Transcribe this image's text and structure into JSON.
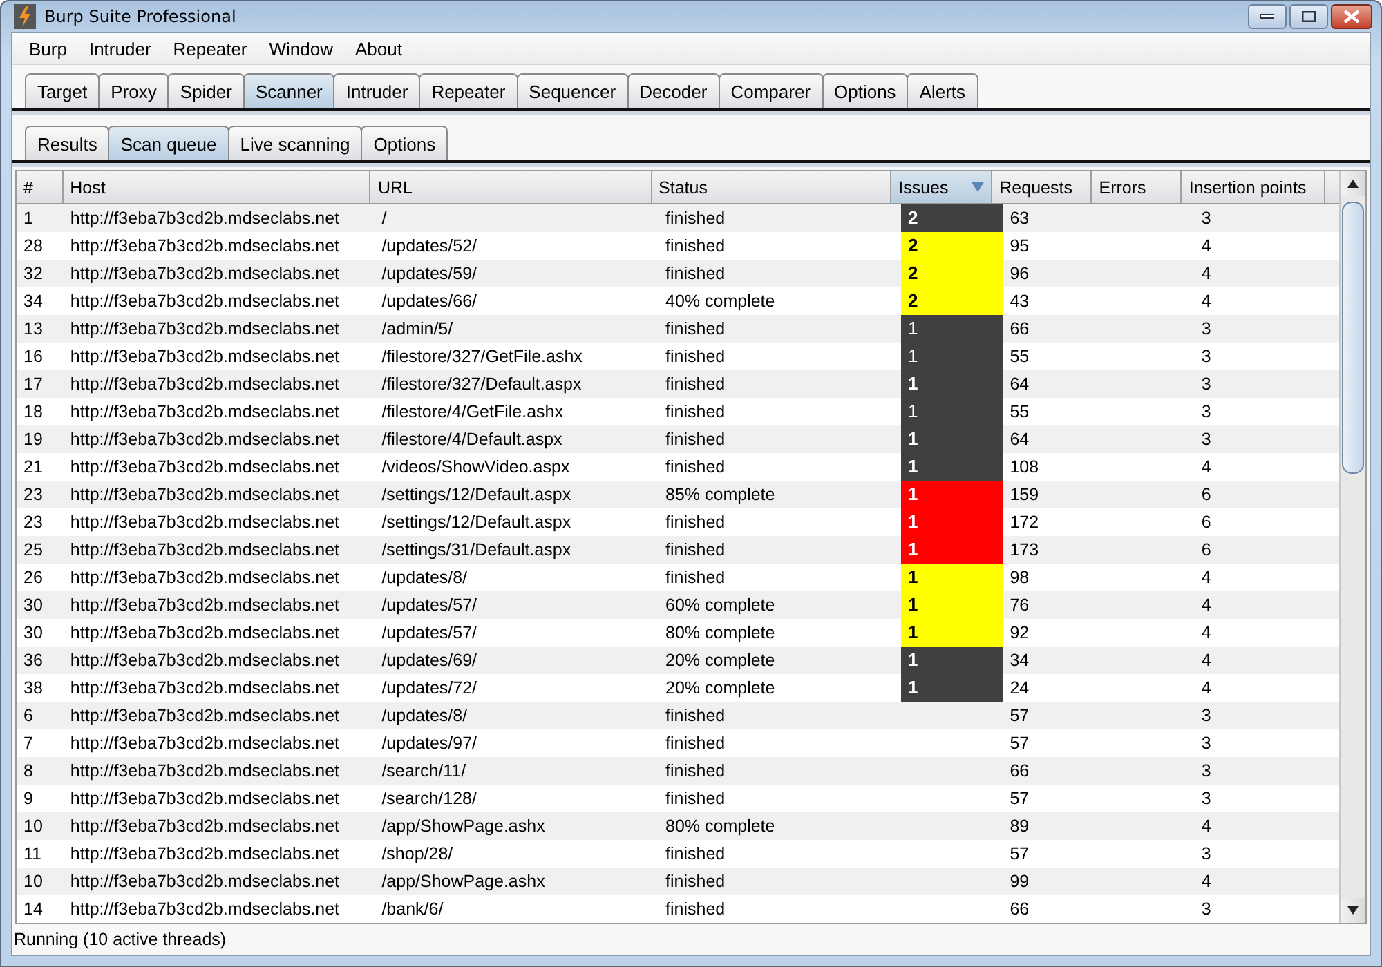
{
  "window": {
    "title": "Burp Suite Professional"
  },
  "menu": [
    "Burp",
    "Intruder",
    "Repeater",
    "Window",
    "About"
  ],
  "tabs": [
    {
      "label": "Target",
      "selected": false
    },
    {
      "label": "Proxy",
      "selected": false
    },
    {
      "label": "Spider",
      "selected": false
    },
    {
      "label": "Scanner",
      "selected": true
    },
    {
      "label": "Intruder",
      "selected": false
    },
    {
      "label": "Repeater",
      "selected": false
    },
    {
      "label": "Sequencer",
      "selected": false
    },
    {
      "label": "Decoder",
      "selected": false
    },
    {
      "label": "Comparer",
      "selected": false
    },
    {
      "label": "Options",
      "selected": false
    },
    {
      "label": "Alerts",
      "selected": false
    }
  ],
  "subtabs": [
    {
      "label": "Results",
      "selected": false
    },
    {
      "label": "Scan queue",
      "selected": true
    },
    {
      "label": "Live scanning",
      "selected": false
    },
    {
      "label": "Options",
      "selected": false
    }
  ],
  "table": {
    "columns": [
      {
        "label": "#",
        "sorted": false
      },
      {
        "label": "Host",
        "sorted": false
      },
      {
        "label": "URL",
        "sorted": false
      },
      {
        "label": "Status",
        "sorted": false
      },
      {
        "label": "Issues",
        "sorted": true
      },
      {
        "label": "Requests",
        "sorted": false
      },
      {
        "label": "Errors",
        "sorted": false
      },
      {
        "label": "Insertion points",
        "sorted": false
      }
    ],
    "rows": [
      {
        "n": "1",
        "host": "http://f3eba7b3cd2b.mdseclabs.net",
        "url": "/",
        "status": "finished",
        "issues": {
          "count": "2",
          "color": "#404040",
          "bold": true
        },
        "requests": "63",
        "points": "3"
      },
      {
        "n": "28",
        "host": "http://f3eba7b3cd2b.mdseclabs.net",
        "url": "/updates/52/",
        "status": "finished",
        "issues": {
          "count": "2",
          "color": "#ffff00",
          "bold": true
        },
        "requests": "95",
        "points": "4"
      },
      {
        "n": "32",
        "host": "http://f3eba7b3cd2b.mdseclabs.net",
        "url": "/updates/59/",
        "status": "finished",
        "issues": {
          "count": "2",
          "color": "#ffff00",
          "bold": true
        },
        "requests": "96",
        "points": "4"
      },
      {
        "n": "34",
        "host": "http://f3eba7b3cd2b.mdseclabs.net",
        "url": "/updates/66/",
        "status": "40% complete",
        "issues": {
          "count": "2",
          "color": "#ffff00",
          "bold": true
        },
        "requests": "43",
        "points": "4"
      },
      {
        "n": "13",
        "host": "http://f3eba7b3cd2b.mdseclabs.net",
        "url": "/admin/5/",
        "status": "finished",
        "issues": {
          "count": "1",
          "color": "#404040",
          "bold": false
        },
        "requests": "66",
        "points": "3"
      },
      {
        "n": "16",
        "host": "http://f3eba7b3cd2b.mdseclabs.net",
        "url": "/filestore/327/GetFile.ashx",
        "status": "finished",
        "issues": {
          "count": "1",
          "color": "#404040",
          "bold": false
        },
        "requests": "55",
        "points": "3"
      },
      {
        "n": "17",
        "host": "http://f3eba7b3cd2b.mdseclabs.net",
        "url": "/filestore/327/Default.aspx",
        "status": "finished",
        "issues": {
          "count": "1",
          "color": "#404040",
          "bold": true
        },
        "requests": "64",
        "points": "3"
      },
      {
        "n": "18",
        "host": "http://f3eba7b3cd2b.mdseclabs.net",
        "url": "/filestore/4/GetFile.ashx",
        "status": "finished",
        "issues": {
          "count": "1",
          "color": "#404040",
          "bold": false
        },
        "requests": "55",
        "points": "3"
      },
      {
        "n": "19",
        "host": "http://f3eba7b3cd2b.mdseclabs.net",
        "url": "/filestore/4/Default.aspx",
        "status": "finished",
        "issues": {
          "count": "1",
          "color": "#404040",
          "bold": true
        },
        "requests": "64",
        "points": "3"
      },
      {
        "n": "21",
        "host": "http://f3eba7b3cd2b.mdseclabs.net",
        "url": "/videos/ShowVideo.aspx",
        "status": "finished",
        "issues": {
          "count": "1",
          "color": "#404040",
          "bold": true
        },
        "requests": "108",
        "points": "4"
      },
      {
        "n": "23",
        "host": "http://f3eba7b3cd2b.mdseclabs.net",
        "url": "/settings/12/Default.aspx",
        "status": "85% complete",
        "issues": {
          "count": "1",
          "color": "#ff0000",
          "bold": true
        },
        "requests": "159",
        "points": "6"
      },
      {
        "n": "23",
        "host": "http://f3eba7b3cd2b.mdseclabs.net",
        "url": "/settings/12/Default.aspx",
        "status": "finished",
        "issues": {
          "count": "1",
          "color": "#ff0000",
          "bold": true
        },
        "requests": "172",
        "points": "6"
      },
      {
        "n": "25",
        "host": "http://f3eba7b3cd2b.mdseclabs.net",
        "url": "/settings/31/Default.aspx",
        "status": "finished",
        "issues": {
          "count": "1",
          "color": "#ff0000",
          "bold": true
        },
        "requests": "173",
        "points": "6"
      },
      {
        "n": "26",
        "host": "http://f3eba7b3cd2b.mdseclabs.net",
        "url": "/updates/8/",
        "status": "finished",
        "issues": {
          "count": "1",
          "color": "#ffff00",
          "bold": true
        },
        "requests": "98",
        "points": "4"
      },
      {
        "n": "30",
        "host": "http://f3eba7b3cd2b.mdseclabs.net",
        "url": "/updates/57/",
        "status": "60% complete",
        "issues": {
          "count": "1",
          "color": "#ffff00",
          "bold": true
        },
        "requests": "76",
        "points": "4"
      },
      {
        "n": "30",
        "host": "http://f3eba7b3cd2b.mdseclabs.net",
        "url": "/updates/57/",
        "status": "80% complete",
        "issues": {
          "count": "1",
          "color": "#ffff00",
          "bold": true
        },
        "requests": "92",
        "points": "4"
      },
      {
        "n": "36",
        "host": "http://f3eba7b3cd2b.mdseclabs.net",
        "url": "/updates/69/",
        "status": "20% complete",
        "issues": {
          "count": "1",
          "color": "#404040",
          "bold": true
        },
        "requests": "34",
        "points": "4"
      },
      {
        "n": "38",
        "host": "http://f3eba7b3cd2b.mdseclabs.net",
        "url": "/updates/72/",
        "status": "20% complete",
        "issues": {
          "count": "1",
          "color": "#404040",
          "bold": true
        },
        "requests": "24",
        "points": "4"
      },
      {
        "n": "6",
        "host": "http://f3eba7b3cd2b.mdseclabs.net",
        "url": "/updates/8/",
        "status": "finished",
        "requests": "57",
        "points": "3"
      },
      {
        "n": "7",
        "host": "http://f3eba7b3cd2b.mdseclabs.net",
        "url": "/updates/97/",
        "status": "finished",
        "requests": "57",
        "points": "3"
      },
      {
        "n": "8",
        "host": "http://f3eba7b3cd2b.mdseclabs.net",
        "url": "/search/11/",
        "status": "finished",
        "requests": "66",
        "points": "3"
      },
      {
        "n": "9",
        "host": "http://f3eba7b3cd2b.mdseclabs.net",
        "url": "/search/128/",
        "status": "finished",
        "requests": "57",
        "points": "3"
      },
      {
        "n": "10",
        "host": "http://f3eba7b3cd2b.mdseclabs.net",
        "url": "/app/ShowPage.ashx",
        "status": "80% complete",
        "requests": "89",
        "points": "4"
      },
      {
        "n": "11",
        "host": "http://f3eba7b3cd2b.mdseclabs.net",
        "url": "/shop/28/",
        "status": "finished",
        "requests": "57",
        "points": "3"
      },
      {
        "n": "10",
        "host": "http://f3eba7b3cd2b.mdseclabs.net",
        "url": "/app/ShowPage.ashx",
        "status": "finished",
        "requests": "99",
        "points": "4"
      },
      {
        "n": "14",
        "host": "http://f3eba7b3cd2b.mdseclabs.net",
        "url": "/bank/6/",
        "status": "finished",
        "requests": "66",
        "points": "3"
      }
    ]
  },
  "status_bar": "Running (10 active threads)"
}
